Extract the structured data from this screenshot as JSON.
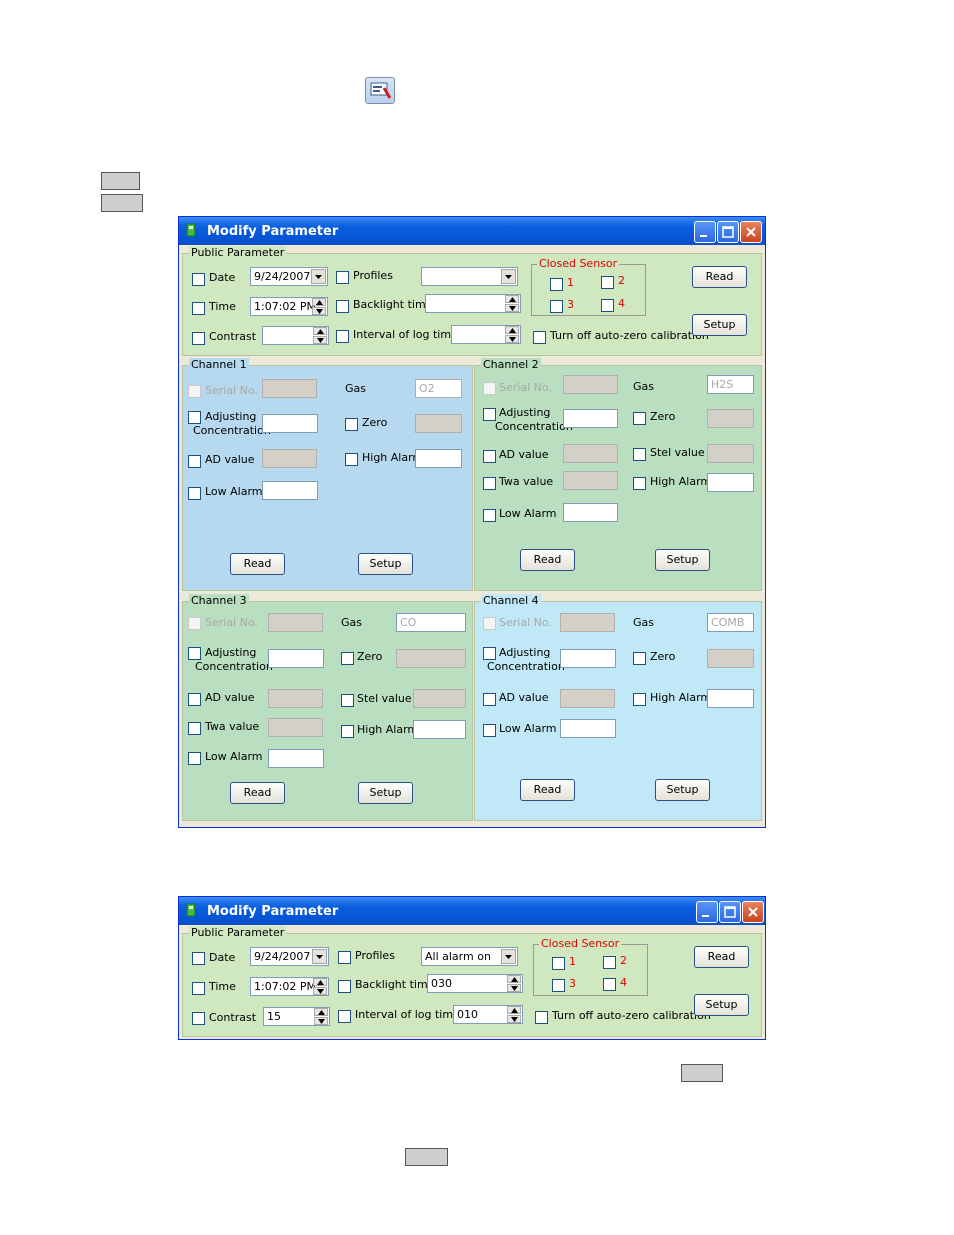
{
  "page": {
    "window_title": "Modify Parameter",
    "public_title": "Public Parameter",
    "closed_sensor_title": "Closed Sensor",
    "sensor_numbers": [
      "1",
      "2",
      "3",
      "4"
    ],
    "labels": {
      "date": "Date",
      "time": "Time",
      "contrast": "Contrast",
      "profiles": "Profiles",
      "backlight": "Backlight time",
      "interval": "Interval of log time",
      "auto_zero": "Turn off auto-zero calibration",
      "read": "Read",
      "setup": "Setup",
      "serial": "Serial No.",
      "gas": "Gas",
      "adjusting": "Adjusting",
      "concentration": "Concentration",
      "zero": "Zero",
      "ad_value": "AD value",
      "high_alarm": "High Alarm",
      "low_alarm": "Low Alarm",
      "stel_value": "Stel value",
      "twa_value": "Twa value"
    },
    "colors": {
      "title_bar": "#0a5ee0",
      "channel1_bg": "#b7d9ef",
      "channel2_bg": "#b9dfc0",
      "channel3_bg": "#b9dfc0",
      "channel4_bg": "#c1e8f7",
      "closed_sensor": "#e00000"
    }
  },
  "window1": {
    "date_value": "9/24/2007",
    "time_value": "1:07:02 PM",
    "contrast_value": "",
    "profiles_value": "",
    "backlight_value": "",
    "interval_value": "",
    "channels": {
      "ch1": {
        "title": "Channel 1",
        "gas": "O2"
      },
      "ch2": {
        "title": "Channel 2",
        "gas": "H2S"
      },
      "ch3": {
        "title": "Channel 3",
        "gas": "CO"
      },
      "ch4": {
        "title": "Channel 4",
        "gas": "COMB"
      }
    }
  },
  "window2": {
    "date_value": "9/24/2007",
    "time_value": "1:07:02 PM",
    "contrast_value": "15",
    "profiles_value": "All alarm on",
    "backlight_value": "030",
    "interval_value": "010"
  }
}
